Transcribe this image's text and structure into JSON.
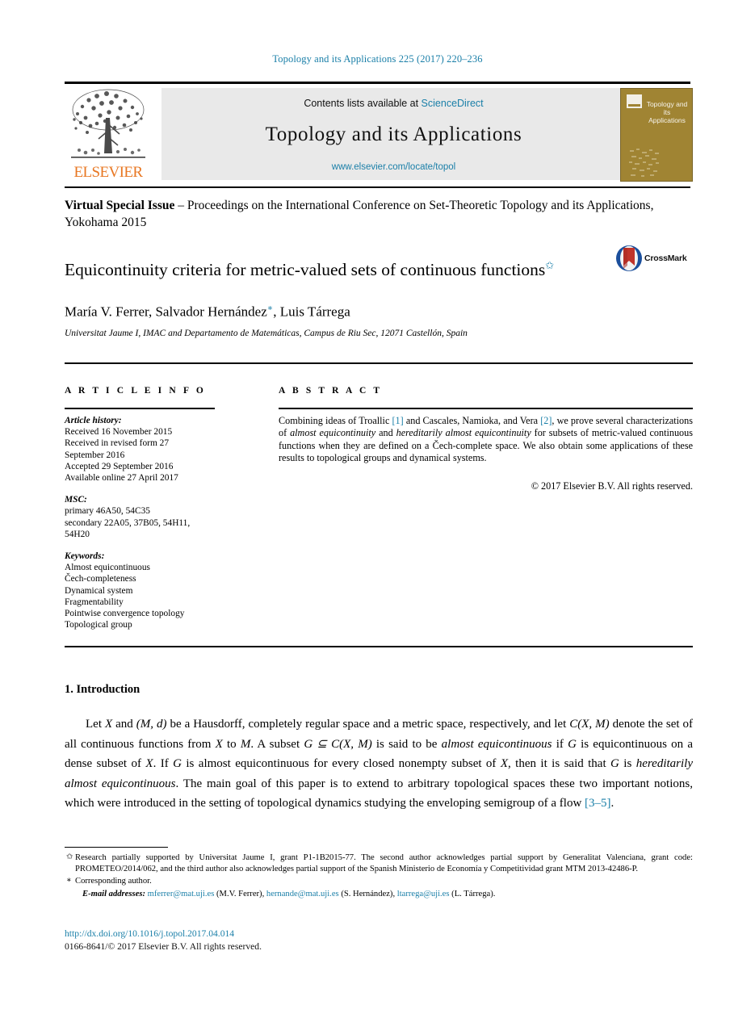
{
  "running_head": "Topology and its Applications 225 (2017) 220–236",
  "masthead": {
    "publisher_name": "ELSEVIER",
    "contents_prefix": "Contents lists available at ",
    "contents_link": "ScienceDirect",
    "journal_title": "Topology and its Applications",
    "journal_url": "www.elsevier.com/locate/topol",
    "cover_title": "Topology and its Applications"
  },
  "special_issue": {
    "label": "Virtual Special Issue",
    "rest": " – Proceedings on the International Conference on Set-Theoretic Topology and its Applications, Yokohama 2015"
  },
  "article": {
    "title": "Equicontinuity criteria for metric-valued sets of continuous functions",
    "title_footnote_mark": "✩",
    "crossmark_label": "CrossMark",
    "authors": "María V. Ferrer, Salvador Hernández",
    "authors_corresponding_mark": "∗",
    "authors_tail": ", Luis Tárrega",
    "affiliation": "Universitat Jaume I, IMAC and Departamento de Matemáticas, Campus de Riu Sec, 12071 Castellón, Spain"
  },
  "columns": {
    "info_heading": "A R T I C L E   I N F O",
    "abstract_heading": "A B S T R A C T"
  },
  "info": {
    "history_label": "Article history:",
    "history_lines": [
      "Received 16 November 2015",
      "Received in revised form 27",
      "September 2016",
      "Accepted 29 September 2016",
      "Available online 27 April 2017"
    ],
    "msc_label": "MSC:",
    "msc_lines": [
      "primary 46A50, 54C35",
      "secondary 22A05, 37B05, 54H11,",
      "54H20"
    ],
    "keywords_label": "Keywords:",
    "keywords": [
      "Almost equicontinuous",
      "Čech-completeness",
      "Dynamical system",
      "Fragmentability",
      "Pointwise convergence topology",
      "Topological group"
    ]
  },
  "abstract": {
    "p1_a": "Combining ideas of Troallic ",
    "ref1": "[1]",
    "p1_b": " and Cascales, Namioka, and Vera ",
    "ref2": "[2]",
    "p1_c": ", we prove several characterizations of ",
    "em1": "almost equicontinuity",
    "p1_d": " and ",
    "em2": "hereditarily almost equicontinuity",
    "p1_e": " for subsets of metric-valued continuous functions when they are defined on a Čech-complete space. We also obtain some applications of these results to topological groups and dynamical systems.",
    "copyright": "© 2017 Elsevier B.V. All rights reserved."
  },
  "introduction": {
    "heading": "1. Introduction",
    "t1": "Let ",
    "m1": "X",
    "t2": " and ",
    "m2": "(M, d)",
    "t3": " be a Hausdorff, completely regular space and a metric space, respectively, and let ",
    "m3": "C(X, M)",
    "t4": " denote the set of all continuous functions from ",
    "m4": "X",
    "t5": " to ",
    "m5": "M",
    "t6": ". A subset ",
    "m6": "G ⊆ C(X, M)",
    "t7": " is said to be ",
    "em1": "almost equicontinuous",
    "t8": " if ",
    "m7": "G",
    "t9": " is equicontinuous on a dense subset of ",
    "m8": "X",
    "t10": ". If ",
    "m9": "G",
    "t11": " is almost equicontinuous for every closed nonempty subset of ",
    "m10": "X",
    "t12": ", then it is said that ",
    "m11": "G",
    "t13": " is ",
    "em2": "hereditarily almost equicontinuous",
    "t14": ". The main goal of this paper is to extend to arbitrary topological spaces these two important notions, which were introduced in the setting of topological dynamics studying the enveloping semigroup of a flow ",
    "ref3": "[3–5]",
    "t15": "."
  },
  "footnotes": {
    "star_mark": "✩",
    "funding": "Research partially supported by Universitat Jaume I, grant P1-1B2015-77. The second author acknowledges partial support by Generalitat Valenciana, grant code: PROMETEO/2014/062, and the third author also acknowledges partial support of the Spanish Ministerio de Economía y Competitividad grant MTM 2013-42486-P.",
    "corr_mark": "∗",
    "corresponding": "Corresponding author.",
    "emails_label": "E-mail addresses:",
    "emails": [
      {
        "address": "mferrer@mat.uji.es",
        "person": "(M.V. Ferrer)"
      },
      {
        "address": "hernande@mat.uji.es",
        "person": "(S. Hernández)"
      },
      {
        "address": "ltarrega@uji.es",
        "person": "(L. Tárrega)"
      }
    ],
    "doi": "http://dx.doi.org/10.1016/j.topol.2017.04.014",
    "issn": "0166-8641/© 2017 Elsevier B.V. All rights reserved."
  },
  "colors": {
    "link": "#1a7fa8",
    "elsevier_orange": "#e87722",
    "cover_tan": "#a08433",
    "banner_gray": "#e9e9e9"
  }
}
